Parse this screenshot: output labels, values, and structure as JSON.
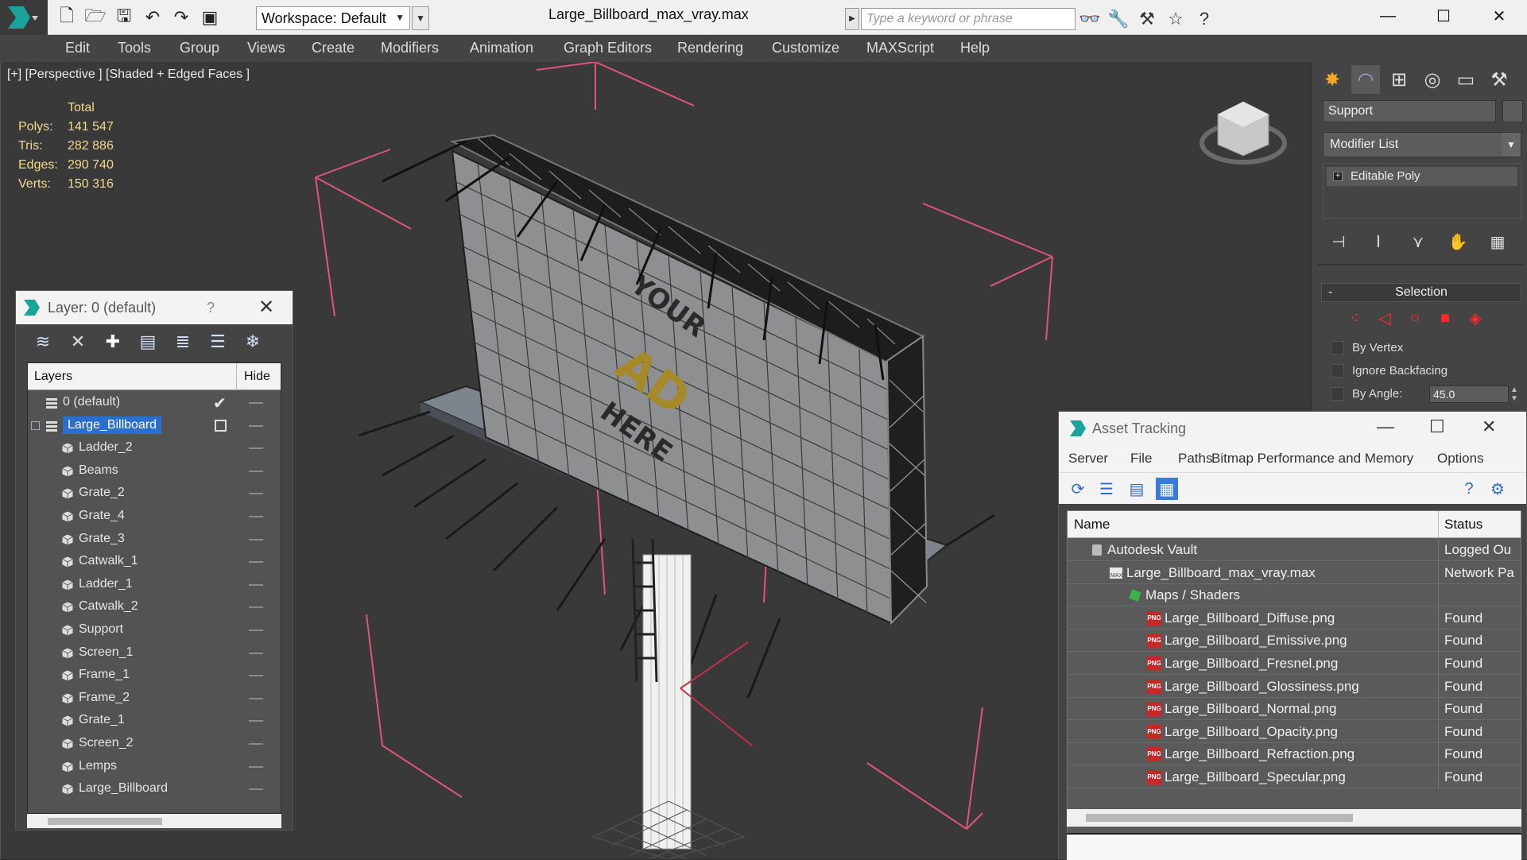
{
  "titlebar": {
    "workspace": "Workspace: Default",
    "document_title": "Large_Billboard_max_vray.max",
    "search_placeholder": "Type a keyword or phrase",
    "minimize": "—",
    "maximize": "☐",
    "close": "✕"
  },
  "menu": [
    "Edit",
    "Tools",
    "Group",
    "Views",
    "Create",
    "Modifiers",
    "Animation",
    "Graph Editors",
    "Rendering",
    "Customize",
    "MAXScript",
    "Help"
  ],
  "viewport": {
    "label": "[+] [Perspective ] [Shaded + Edged Faces ]",
    "stats": {
      "header": "Total",
      "rows": [
        {
          "key": "Polys:",
          "value": "141 547"
        },
        {
          "key": "Tris:",
          "value": "282 886"
        },
        {
          "key": "Edges:",
          "value": "290 740"
        },
        {
          "key": "Verts:",
          "value": "150 316"
        }
      ]
    },
    "billboard_text": [
      "YOUR",
      "AD",
      "HERE"
    ]
  },
  "layer_dialog": {
    "title": "Layer: 0 (default)",
    "help": "?",
    "close": "✕",
    "col_layers": "Layers",
    "col_hide": "Hide",
    "rows": [
      {
        "label": "0 (default)",
        "type": "layer",
        "active": true
      },
      {
        "label": "Large_Billboard",
        "type": "layer",
        "selected": true
      },
      {
        "label": "Ladder_2",
        "type": "object"
      },
      {
        "label": "Beams",
        "type": "object"
      },
      {
        "label": "Grate_2",
        "type": "object"
      },
      {
        "label": "Grate_4",
        "type": "object"
      },
      {
        "label": "Grate_3",
        "type": "object"
      },
      {
        "label": "Catwalk_1",
        "type": "object"
      },
      {
        "label": "Ladder_1",
        "type": "object"
      },
      {
        "label": "Catwalk_2",
        "type": "object"
      },
      {
        "label": "Support",
        "type": "object"
      },
      {
        "label": "Screen_1",
        "type": "object"
      },
      {
        "label": "Frame_1",
        "type": "object"
      },
      {
        "label": "Frame_2",
        "type": "object"
      },
      {
        "label": "Grate_1",
        "type": "object"
      },
      {
        "label": "Screen_2",
        "type": "object"
      },
      {
        "label": "Lemps",
        "type": "object"
      },
      {
        "label": "Large_Billboard",
        "type": "object"
      }
    ]
  },
  "command_panel": {
    "object_name": "Support",
    "modifier_list": "Modifier List",
    "stack_item": "Editable Poly",
    "selection_title": "Selection",
    "by_vertex": "By Vertex",
    "ignore_backfacing": "Ignore Backfacing",
    "by_angle": "By Angle:",
    "angle_value": "45.0"
  },
  "asset_tracking": {
    "title": "Asset Tracking",
    "menu": [
      "Server",
      "File",
      "Paths",
      "Bitmap Performance and Memory",
      "Options"
    ],
    "col_name": "Name",
    "col_status": "Status",
    "rows": [
      {
        "label": "Autodesk Vault",
        "status": "Logged Ou",
        "level": 1,
        "icon": "vault"
      },
      {
        "label": "Large_Billboard_max_vray.max",
        "status": "Network Pa",
        "level": 2,
        "icon": "max"
      },
      {
        "label": "Maps / Shaders",
        "status": "",
        "level": 3,
        "icon": "maps"
      },
      {
        "label": "Large_Billboard_Diffuse.png",
        "status": "Found",
        "level": 4,
        "icon": "png"
      },
      {
        "label": "Large_Billboard_Emissive.png",
        "status": "Found",
        "level": 4,
        "icon": "png"
      },
      {
        "label": "Large_Billboard_Fresnel.png",
        "status": "Found",
        "level": 4,
        "icon": "png"
      },
      {
        "label": "Large_Billboard_Glossiness.png",
        "status": "Found",
        "level": 4,
        "icon": "png"
      },
      {
        "label": "Large_Billboard_Normal.png",
        "status": "Found",
        "level": 4,
        "icon": "png"
      },
      {
        "label": "Large_Billboard_Opacity.png",
        "status": "Found",
        "level": 4,
        "icon": "png"
      },
      {
        "label": "Large_Billboard_Refraction.png",
        "status": "Found",
        "level": 4,
        "icon": "png"
      },
      {
        "label": "Large_Billboard_Specular.png",
        "status": "Found",
        "level": 4,
        "icon": "png"
      }
    ]
  }
}
